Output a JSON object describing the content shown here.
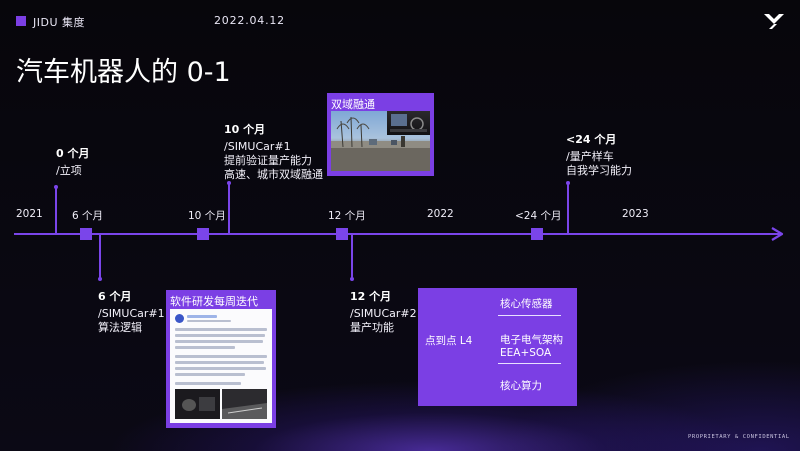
{
  "header": {
    "brand": "JIDU 集度",
    "date": "2022.04.12",
    "title": "汽车机器人的 0-1",
    "footer": "PROPRIETARY & CONFIDENTIAL"
  },
  "timeline": {
    "labels": [
      "2021",
      "6 个月",
      "10 个月",
      "12 个月",
      "2022",
      "<24 个月",
      "2023"
    ]
  },
  "events": {
    "m0": {
      "title": "0 个月",
      "lines": [
        "/立项"
      ]
    },
    "m6": {
      "title": "6 个月",
      "lines": [
        "/SIMUCar#1",
        "算法逻辑"
      ]
    },
    "m10": {
      "title": "10 个月",
      "lines": [
        "/SIMUCar#1",
        "提前验证量产能力",
        "高速、城市双域融通"
      ]
    },
    "m12": {
      "title": "12 个月",
      "lines": [
        "/SIMUCar#2",
        "量产功能"
      ]
    },
    "m24": {
      "title": "<24 个月",
      "lines": [
        "/量产样车",
        "自我学习能力"
      ]
    }
  },
  "cards": {
    "fusion_title": "双域融通",
    "iteration_title": "软件研发每周迭代"
  },
  "architecture": {
    "left": "点到点 L4",
    "items": [
      "核心传感器",
      "电子电气架构",
      "EEA+SOA",
      "核心算力"
    ]
  },
  "colors": {
    "accent": "#7b3fe4",
    "background": "#08070d"
  }
}
